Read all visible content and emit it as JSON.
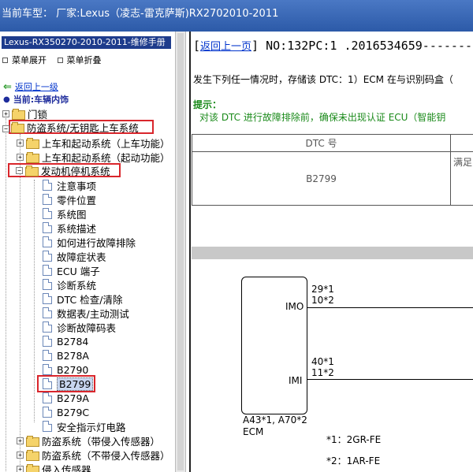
{
  "window": {
    "title": "当前车型： 厂家:Lexus（凌志-雷克萨斯)RX2702010-2011"
  },
  "left": {
    "manual_title": "Lexus-RX350270-2010-2011-维修手册",
    "menu_expand": "菜单展开",
    "menu_collapse": "菜单折叠",
    "back_link": "返回上一级",
    "current": "当前:车辆内饰",
    "tree": {
      "door_lock": "门锁",
      "anti_theft": "防盗系统/无钥匙上车系统",
      "entry_start_1": "上车和起动系统（上车功能）",
      "entry_start_2": "上车和起动系统（起动功能）",
      "immobiliser": "发动机停机系统",
      "items": [
        "注意事项",
        "零件位置",
        "系统图",
        "系统描述",
        "如何进行故障排除",
        "故障症状表",
        "ECU 端子",
        "诊断系统",
        "DTC 检查/清除",
        "数据表/主动测试",
        "诊断故障码表",
        "B2784",
        "B278A",
        "B2790",
        "B2799",
        "B279A",
        "B279C",
        "安全指示灯电路"
      ],
      "anti_theft_intrusion": "防盗系统（带侵入传感器）",
      "anti_theft_no_intrusion": "防盗系统（不带侵入传感器）",
      "intrusion_sensor": "侵入传感器"
    }
  },
  "right": {
    "back_link": "返回上一页",
    "doc_no": "NO:132PC:1 .2016534659-----------",
    "condition": "发生下列任一情况时，存储该 DTC：1）ECM 在与识别码盒（",
    "hint_title": "提示：",
    "hint_body": "对该 DTC 进行故障排除前，确保未出现认证 ECU（智能钥",
    "table": {
      "col1_header": "DTC 号",
      "col2_header": "",
      "dtc_code": "B2799",
      "col2_value": "满足"
    },
    "diagram": {
      "pin_imo_numbers": [
        "29*1",
        "10*2"
      ],
      "pin_imo_label": "IMO",
      "pin_imi_numbers": [
        "40*1",
        "11*2"
      ],
      "pin_imi_label": "IMI",
      "ecu_connector": "A43*1, A70*2",
      "ecu_name": "ECM",
      "note1": "*1：2GR-FE",
      "note2": "*2：1AR-FE"
    }
  }
}
